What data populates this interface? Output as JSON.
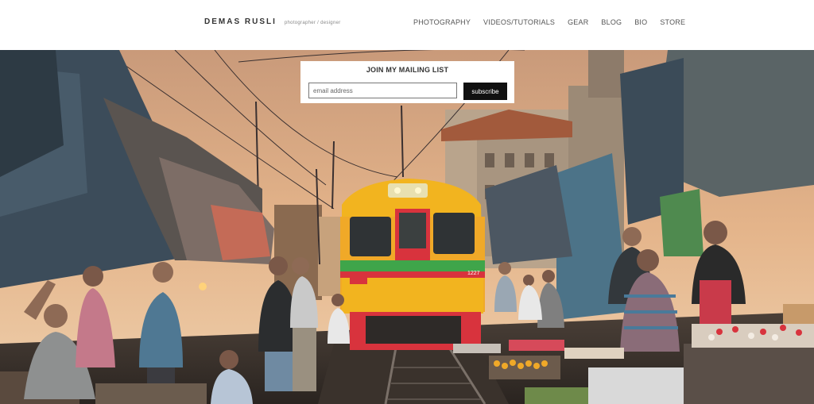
{
  "brand": {
    "name": "DEMAS RUSLI",
    "tagline": "photographer / designer"
  },
  "nav": [
    {
      "label": "PHOTOGRAPHY"
    },
    {
      "label": "VIDEOS/TUTORIALS"
    },
    {
      "label": "GEAR"
    },
    {
      "label": "BLOG"
    },
    {
      "label": "BIO"
    },
    {
      "label": "STORE"
    }
  ],
  "hero": {
    "train_number": "1227"
  },
  "mailing": {
    "title": "JOIN MY MAILING LIST",
    "placeholder": "email address",
    "button": "subscribe"
  },
  "colors": {
    "train_red": "#d8333d",
    "train_yellow": "#f2b41f",
    "sky": "#d4a07a",
    "canopy": "#3b4b58"
  }
}
